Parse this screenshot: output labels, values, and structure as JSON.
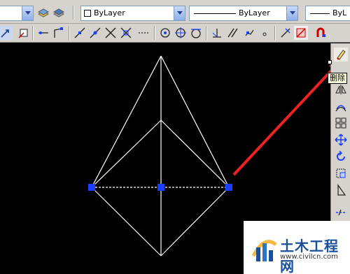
{
  "toolbar_top": {
    "color_value": "ByLayer",
    "linetype_value": "ByLayer",
    "lineweight_value": "ByL"
  },
  "tooltip": {
    "text": "删除"
  },
  "watermark": {
    "title": "土木工程网",
    "url": "www.civilcn.com"
  },
  "colors": {
    "toolbar_bg": "#d6d3ce",
    "canvas_bg": "#000000",
    "grip": "#1a3fff",
    "arrow": "#ee2222"
  },
  "icons": {
    "toolbar_row2": [
      "line-icon",
      "polyline-icon",
      "tangent-icon",
      "extension-icon",
      "intersection-icon",
      "apparent-intersection-icon",
      "center-icon",
      "quadrant-icon",
      "tangent-snap-icon",
      "perpendicular-icon",
      "parallel-icon",
      "node-icon",
      "insert-icon",
      "nearest-icon",
      "none-icon",
      "osnap-settings-icon"
    ],
    "modify_toolbar": [
      "erase-icon",
      "copy-icon",
      "mirror-icon",
      "offset-icon",
      "array-icon",
      "move-icon",
      "rotate-icon",
      "scale-icon",
      "stretch-icon",
      "trim-icon",
      "extend-icon"
    ]
  }
}
